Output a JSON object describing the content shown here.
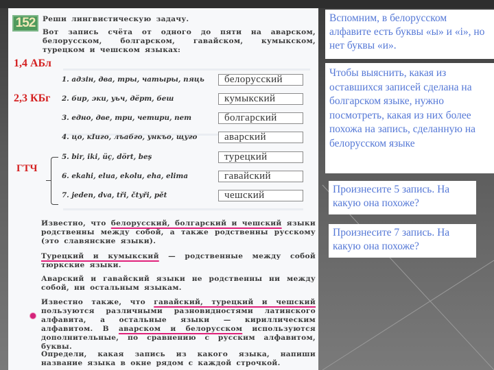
{
  "exercise": {
    "number": "152",
    "title": "Реши лингвистическую задачу.",
    "intro": "Вот запись счёта от одного до пяти на аварском, белорусском, болгарском, гавайском, кумыкском, турецком и чешском языках:",
    "rows": [
      {
        "text": "1. адзін, два, тры, чатыры, пяць",
        "answer": "белорусский"
      },
      {
        "text": "2. бир, эки, уьч, дёрт, беш",
        "answer": "кумыкский"
      },
      {
        "text": "3. едно, две, три, четири, пет",
        "answer": "болгарский"
      },
      {
        "text": "4. цо, кIиго, лъабго, ункъо, щуго",
        "answer": "аварский"
      },
      {
        "text": "5. bir, iki, üç, dört, beş",
        "answer": "турецкий"
      },
      {
        "text": "6. ekahi, elua, ekolu, eha, elima",
        "answer": "гавайский"
      },
      {
        "text": "7. jeden, dva, tři, čtyři, pět",
        "answer": "чешский"
      }
    ],
    "known1": {
      "pre": "Известно, что ",
      "underlined": "белорусский, болгарский и чешский",
      "post": " языки родственны между собой, а также родственны русскому (это славянские языки)."
    },
    "known2": {
      "underlined": "Турецкий и кумыкский",
      "post": " — родственные между собой тюркские языки."
    },
    "known3": "Аварский и гавайский языки не родственны ни между собой, ни остальным языкам.",
    "known4": {
      "pre": "Известно также, что ",
      "underlined1": "гавайский, турецкий и чешский",
      "mid": " пользуются различными разновидностями латинского алфавита, а остальные языки — кириллическим алфавитом. В ",
      "underlined2": "аварском и белорусском",
      "post": " используются дополнительные, по сравнению с русским алфавитом, буквы."
    },
    "task": "Определи, какая запись из какого языка, напиши название языка в окне рядом с каждой строчкой."
  },
  "annotations": {
    "abl": "1,4 АБл",
    "kbg": "2,3 КБг",
    "gtch": "ГТЧ"
  },
  "notes": {
    "note1": "Вспомним, в белорусском алфавите есть буквы «ы» и «і», но нет буквы «и».",
    "note2": "Чтобы выяснить, какая из оставшихся записей сделана на болгарском языке, нужно посмотреть, какая из них более похожа на запись, сделанную на белорусском языке",
    "note3": "Произнесите 5 запись. На какую она похоже?",
    "note4": "Произнесите 7 запись. На какую она похоже?"
  },
  "colors": {
    "note_text": "#5578d6",
    "annotation_red": "#d42020",
    "underline_pink": "#e0217a",
    "badge_green": "#4f9a5c"
  }
}
